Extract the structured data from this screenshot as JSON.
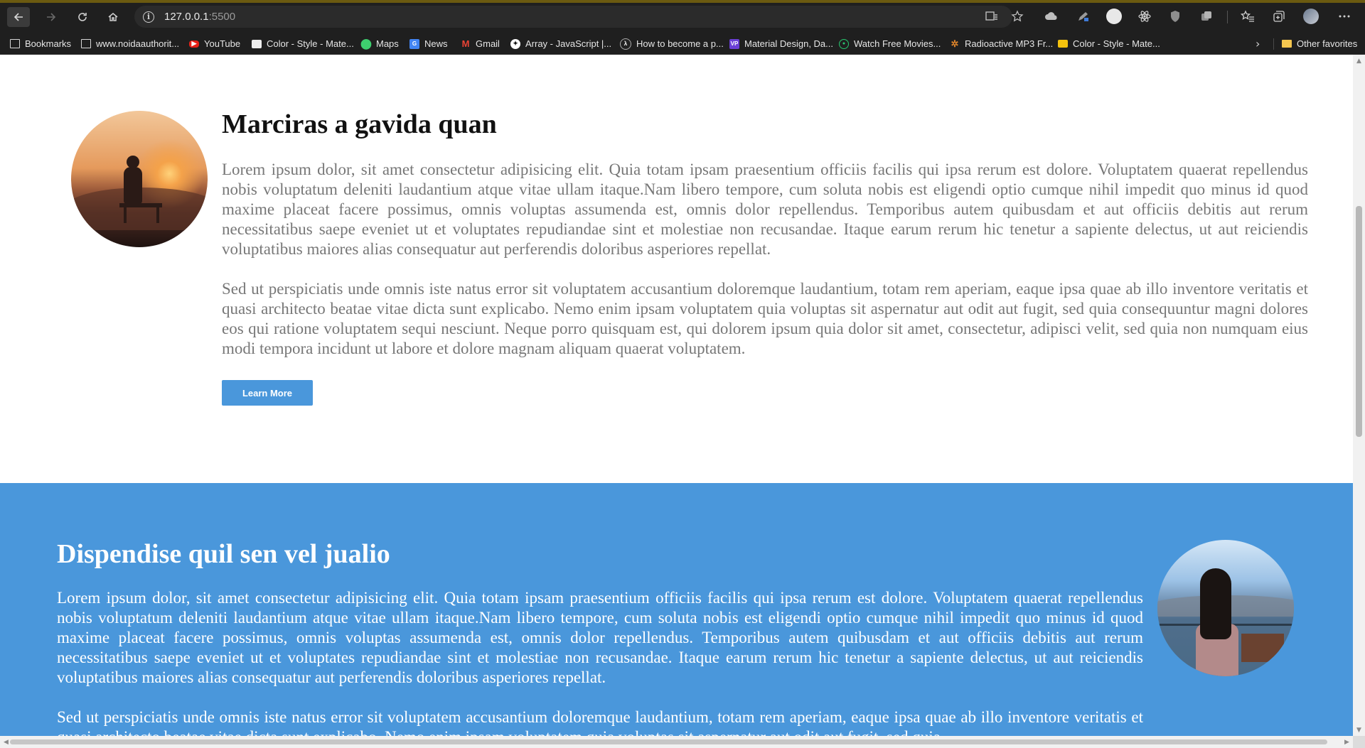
{
  "browser": {
    "url_host": "127.0.0.1",
    "url_port": ":5500",
    "icons": {
      "back": "arrow-left-icon",
      "forward": "arrow-right-icon",
      "refresh": "refresh-icon",
      "home": "home-icon",
      "info": "info-icon"
    }
  },
  "bookmarks": {
    "items": [
      {
        "label": "Bookmarks",
        "icon": "page-icon"
      },
      {
        "label": "www.noidaauthorit...",
        "icon": "page-icon"
      },
      {
        "label": "YouTube",
        "icon": "youtube-icon"
      },
      {
        "label": "Color - Style - Mate...",
        "icon": "material-icon"
      },
      {
        "label": "Maps",
        "icon": "maps-icon"
      },
      {
        "label": "News",
        "icon": "news-icon"
      },
      {
        "label": "Gmail",
        "icon": "gmail-icon"
      },
      {
        "label": "Array - JavaScript |...",
        "icon": "array-icon"
      },
      {
        "label": "How to become a p...",
        "icon": "lambda-icon"
      },
      {
        "label": "Material Design, Da...",
        "icon": "md-icon"
      },
      {
        "label": "Watch Free Movies...",
        "icon": "watch-icon"
      },
      {
        "label": "Radioactive MP3 Fr...",
        "icon": "radio-icon"
      },
      {
        "label": "Color - Style - Mate...",
        "icon": "color-icon"
      }
    ],
    "other": "Other favorites"
  },
  "section1": {
    "title": "Marciras a gavida quan",
    "paragraph1": "Lorem ipsum dolor, sit amet consectetur adipisicing elit. Quia totam ipsam praesentium officiis facilis qui ipsa rerum est dolore. Voluptatem quaerat repellendus nobis voluptatum deleniti laudantium atque vitae ullam itaque.Nam libero tempore, cum soluta nobis est eligendi optio cumque nihil impedit quo minus id quod maxime placeat facere possimus, omnis voluptas assumenda est, omnis dolor repellendus. Temporibus autem quibusdam et aut officiis debitis aut rerum necessitatibus saepe eveniet ut et voluptates repudiandae sint et molestiae non recusandae. Itaque earum rerum hic tenetur a sapiente delectus, ut aut reiciendis voluptatibus maiores alias consequatur aut perferendis doloribus asperiores repellat.",
    "paragraph2": "Sed ut perspiciatis unde omnis iste natus error sit voluptatem accusantium doloremque laudantium, totam rem aperiam, eaque ipsa quae ab illo inventore veritatis et quasi architecto beatae vitae dicta sunt explicabo. Nemo enim ipsam voluptatem quia voluptas sit aspernatur aut odit aut fugit, sed quia consequuntur magni dolores eos qui ratione voluptatem sequi nesciunt. Neque porro quisquam est, qui dolorem ipsum quia dolor sit amet, consectetur, adipisci velit, sed quia non numquam eius modi tempora incidunt ut labore et dolore magnam aliquam quaerat voluptatem.",
    "button": "Learn More"
  },
  "section2": {
    "title": "Dispendise quil sen vel jualio",
    "paragraph1": "Lorem ipsum dolor, sit amet consectetur adipisicing elit. Quia totam ipsam praesentium officiis facilis qui ipsa rerum est dolore. Voluptatem quaerat repellendus nobis voluptatum deleniti laudantium atque vitae ullam itaque.Nam libero tempore, cum soluta nobis est eligendi optio cumque nihil impedit quo minus id quod maxime placeat facere possimus, omnis voluptas assumenda est, omnis dolor repellendus. Temporibus autem quibusdam et aut officiis debitis aut rerum necessitatibus saepe eveniet ut et voluptates repudiandae sint et molestiae non recusandae. Itaque earum rerum hic tenetur a sapiente delectus, ut aut reiciendis voluptatibus maiores alias consequatur aut perferendis doloribus asperiores repellat.",
    "paragraph2": "Sed ut perspiciatis unde omnis iste natus error sit voluptatem accusantium doloremque laudantium, totam rem aperiam, eaque ipsa quae ab illo inventore veritatis et quasi architecto beatae vitae dicta sunt explicabo. Nemo enim ipsam voluptatem quia voluptas sit aspernatur aut odit aut fugit, sed quia"
  },
  "colors": {
    "accent": "#4a97db",
    "body_text": "#777777",
    "title_text": "#111111"
  }
}
